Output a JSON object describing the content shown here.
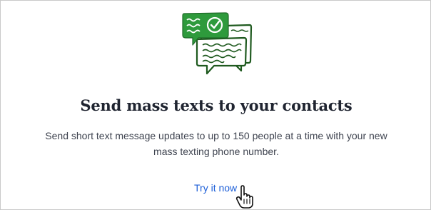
{
  "card": {
    "illustration_icon": "chat-bubbles-check-icon",
    "headline": "Send mass texts to your contacts",
    "description": "Send short text message updates to up to 150 people at a time with your new mass texting phone number.",
    "cta_label": "Try it now",
    "cursor_icon": "hand-pointer-cursor-icon"
  },
  "colors": {
    "illustration_green": "#2e9a3c",
    "illustration_dark": "#1f5a1f",
    "link_blue": "#1d5fd8",
    "heading_text": "#1f2430",
    "body_text": "#3f4450",
    "border": "#c9c9c9"
  }
}
